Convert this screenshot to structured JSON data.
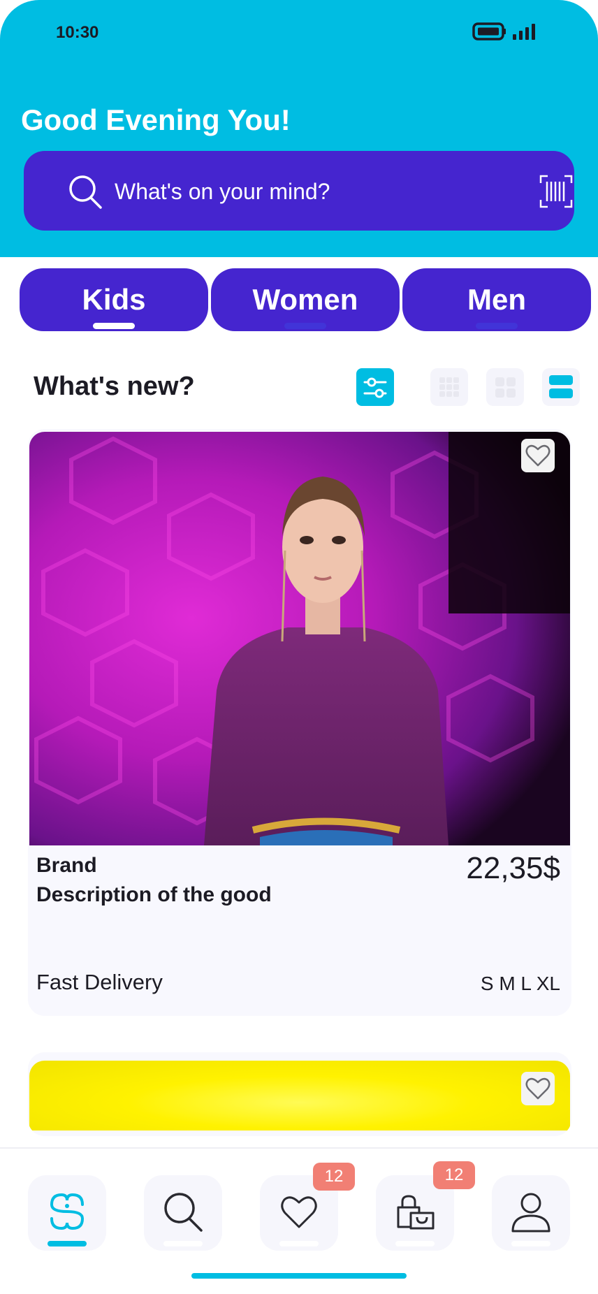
{
  "status_bar": {
    "time": "10:30"
  },
  "header": {
    "greeting": "Good Evening You!",
    "search_placeholder": "What's on your mind?"
  },
  "categories": [
    {
      "label": "Kids",
      "active": true
    },
    {
      "label": "Women",
      "active": false
    },
    {
      "label": "Men",
      "active": false
    }
  ],
  "section": {
    "title": "What's new?"
  },
  "product": {
    "brand": "Brand",
    "description": "Description of the good",
    "price": "22,35$",
    "delivery": "Fast Delivery",
    "sizes": "S M L XL"
  },
  "bottom_nav": {
    "items": [
      {
        "icon": "home-logo-icon",
        "active": true
      },
      {
        "icon": "search-icon",
        "active": false
      },
      {
        "icon": "heart-icon",
        "badge": "12"
      },
      {
        "icon": "shopping-bag-icon",
        "badge": "12"
      },
      {
        "icon": "profile-icon",
        "active": false
      }
    ]
  },
  "colors": {
    "accent": "#00bde2",
    "primary": "#4525cf",
    "badge": "#f17f74",
    "card": "#f8f8fe"
  }
}
